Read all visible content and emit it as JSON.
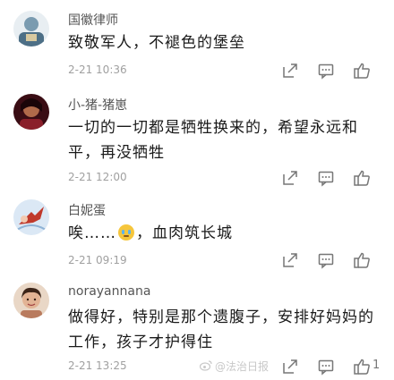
{
  "comments": [
    {
      "username": "国徽律师",
      "lines": [
        "致敬军人，不褪色的堡垒"
      ],
      "time": "2-21 10:36",
      "like_count": "",
      "avatar_color": "#7a9bb0"
    },
    {
      "username": "小-猪-猪崽",
      "lines": [
        "一切的一切都是牺牲换来的，希望永远和",
        "平，再没牺牲"
      ],
      "time": "2-21 12:00",
      "like_count": "",
      "avatar_color": "#6a1f2a"
    },
    {
      "username": "白妮蛋",
      "lines_prefix": "唉……",
      "lines_suffix": "，血肉筑长城",
      "emoji_icon": "crying-face-icon",
      "time": "2-21 09:19",
      "like_count": "",
      "avatar_color": "#c9ddf0"
    },
    {
      "username": "norayannana",
      "lines": [
        "做得好，特别是那个遗腹子，安排好妈妈的",
        "工作，孩子才护得住"
      ],
      "time": "2-21 13:25",
      "like_count": "1",
      "avatar_color": "#b97b5e"
    }
  ],
  "watermark": "@法治日报",
  "icons": {
    "share": "share-icon",
    "comment": "comment-icon",
    "like": "thumbs-up-icon"
  }
}
